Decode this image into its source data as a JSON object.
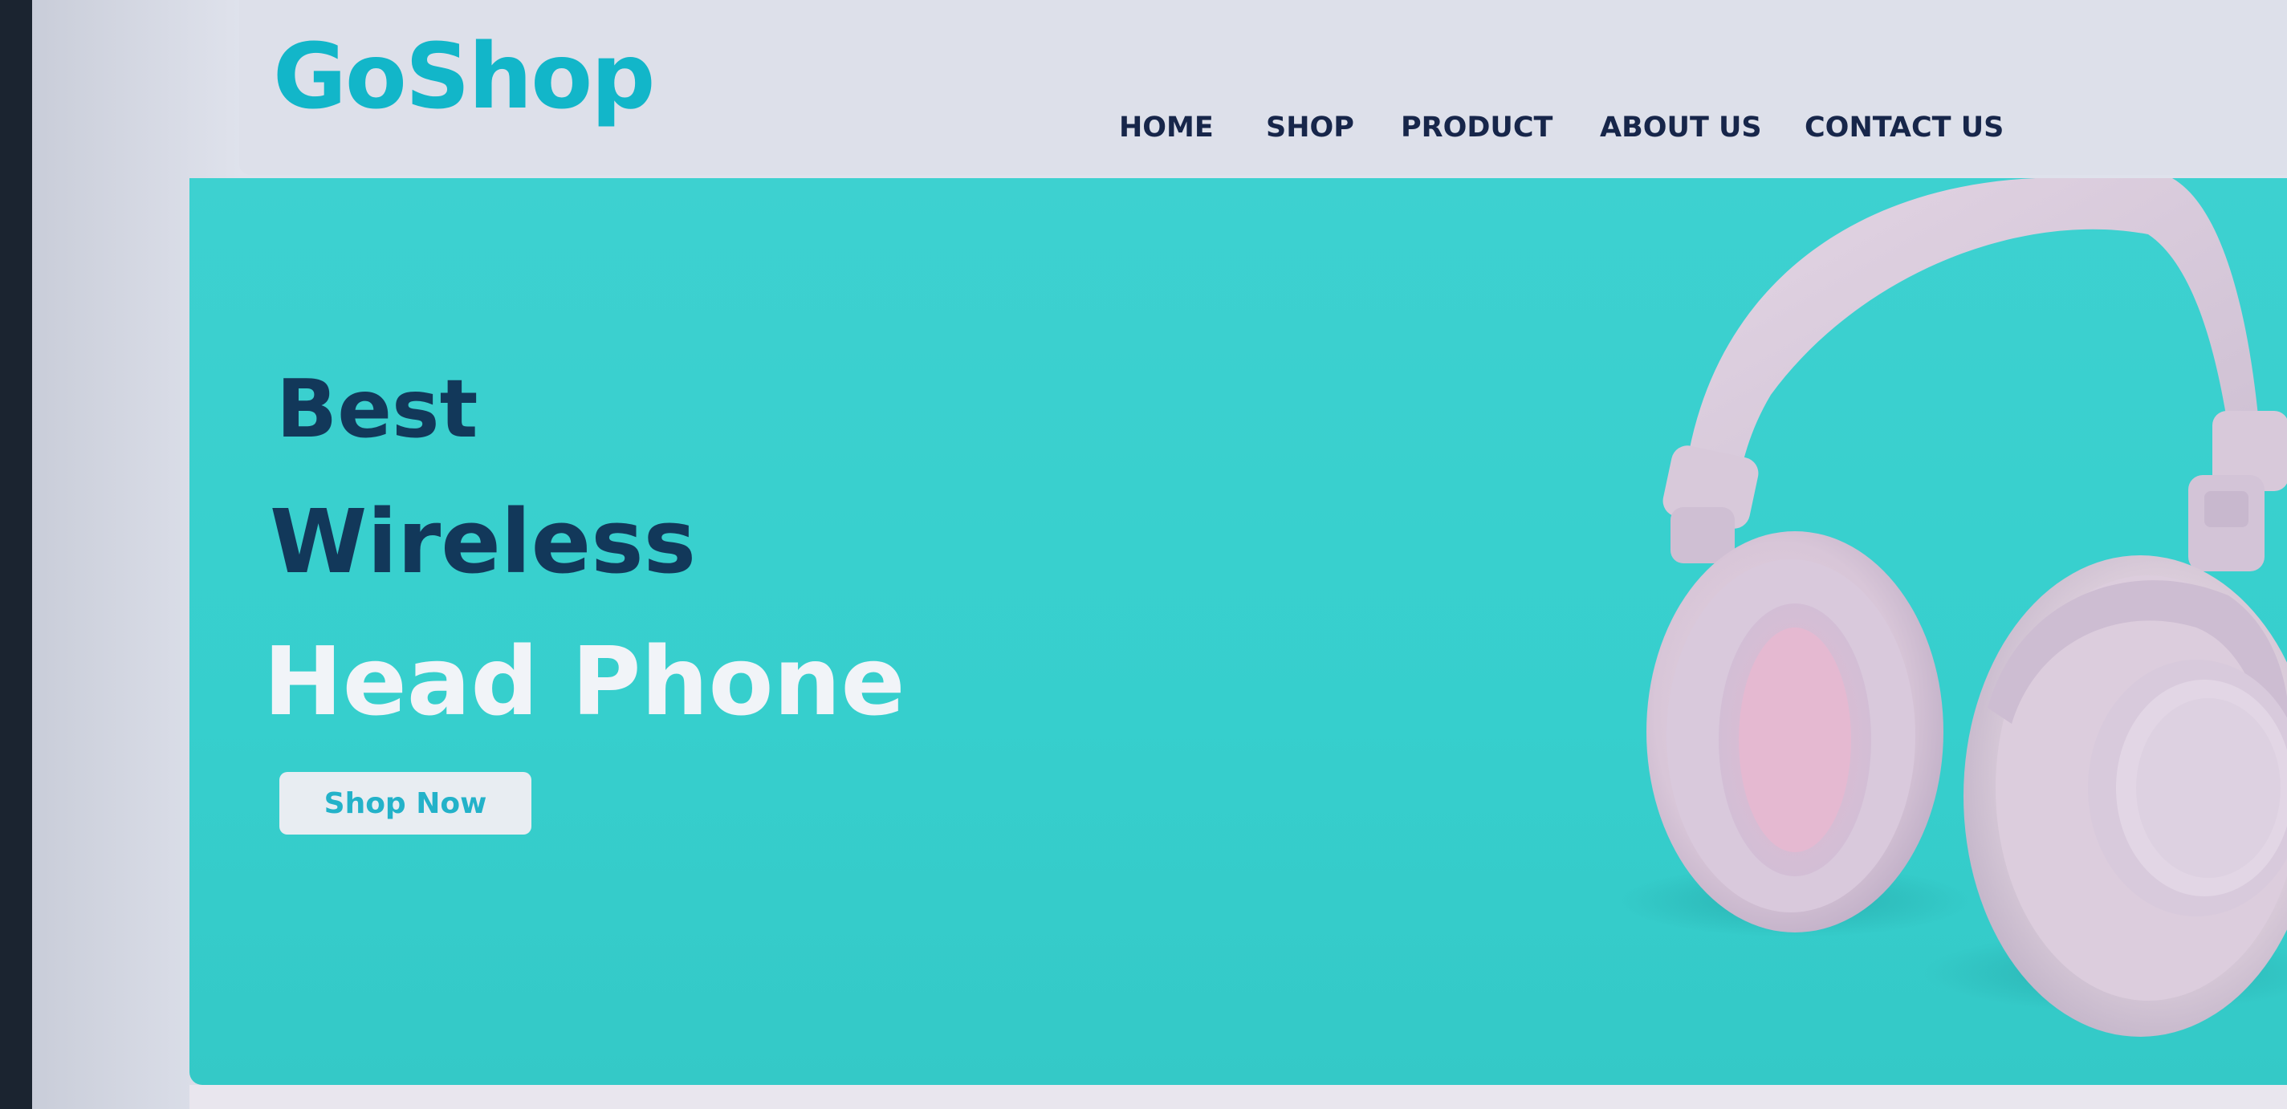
{
  "brand": {
    "logo_text": "GoShop",
    "accent_color": "#12b6c9"
  },
  "nav": {
    "items": [
      {
        "label": "HOME"
      },
      {
        "label": "SHOP"
      },
      {
        "label": "PRODUCT"
      },
      {
        "label": "ABOUT US"
      },
      {
        "label": "CONTACT US"
      }
    ]
  },
  "hero": {
    "line1": "Best",
    "line2": "Wireless",
    "line3": "Head Phone",
    "cta_label": "Shop Now",
    "background_color": "#3dd1d0",
    "image_icon": "headphones-image"
  }
}
